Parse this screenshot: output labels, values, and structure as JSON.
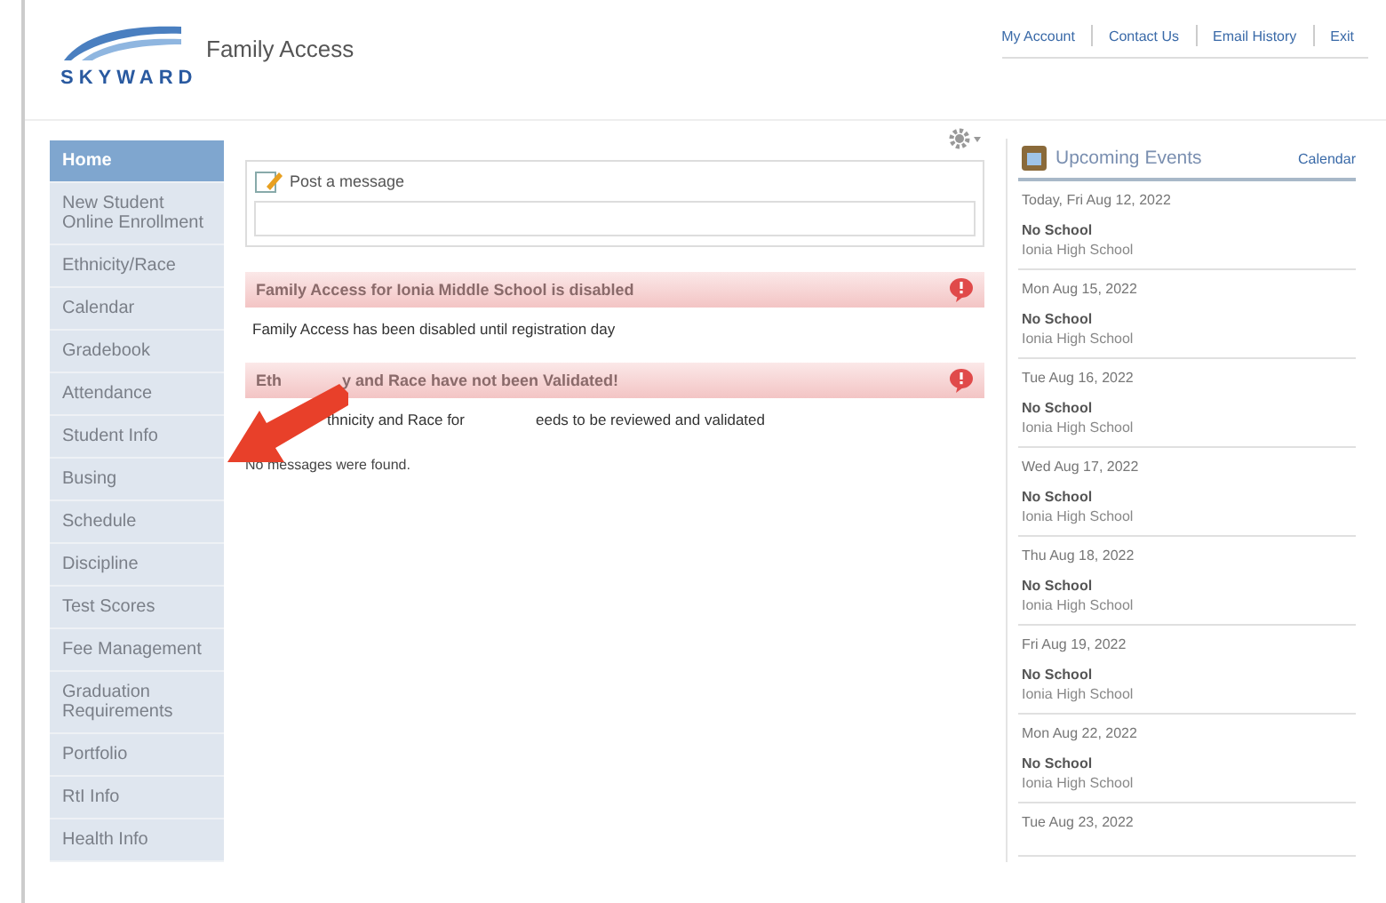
{
  "header": {
    "logo": "SKYWARD",
    "title": "Family Access",
    "links": [
      "My Account",
      "Contact Us",
      "Email History",
      "Exit"
    ]
  },
  "sidebar": {
    "items": [
      {
        "label": "Home",
        "selected": true
      },
      {
        "label": "New Student Online Enrollment",
        "selected": false
      },
      {
        "label": "Ethnicity/Race",
        "selected": false
      },
      {
        "label": "Calendar",
        "selected": false
      },
      {
        "label": "Gradebook",
        "selected": false
      },
      {
        "label": "Attendance",
        "selected": false
      },
      {
        "label": "Student Info",
        "selected": false
      },
      {
        "label": "Busing",
        "selected": false
      },
      {
        "label": "Schedule",
        "selected": false
      },
      {
        "label": "Discipline",
        "selected": false
      },
      {
        "label": "Test Scores",
        "selected": false
      },
      {
        "label": "Fee Management",
        "selected": false
      },
      {
        "label": "Graduation Requirements",
        "selected": false
      },
      {
        "label": "Portfolio",
        "selected": false
      },
      {
        "label": "RtI Info",
        "selected": false
      },
      {
        "label": "Health Info",
        "selected": false
      }
    ]
  },
  "post_box": {
    "label": "Post a message"
  },
  "alerts": [
    {
      "title": [
        "Family Access for Ionia Middle School is disabled"
      ],
      "body": [
        "Family Access has been disabled until registration day"
      ]
    },
    {
      "title": [
        "Eth",
        "y and Race have not been Validated!"
      ],
      "body": [
        "thnicity and Race for",
        "eeds to be reviewed and validated"
      ]
    }
  ],
  "no_messages": "No messages were found.",
  "events": {
    "title": "Upcoming Events",
    "link": "Calendar",
    "items": [
      {
        "date": "Today, Fri Aug 12, 2022",
        "name": "No School",
        "place": "Ionia High School"
      },
      {
        "date": "Mon Aug 15, 2022",
        "name": "No School",
        "place": "Ionia High School"
      },
      {
        "date": "Tue Aug 16, 2022",
        "name": "No School",
        "place": "Ionia High School"
      },
      {
        "date": "Wed Aug 17, 2022",
        "name": "No School",
        "place": "Ionia High School"
      },
      {
        "date": "Thu Aug 18, 2022",
        "name": "No School",
        "place": "Ionia High School"
      },
      {
        "date": "Fri Aug 19, 2022",
        "name": "No School",
        "place": "Ionia High School"
      },
      {
        "date": "Mon Aug 22, 2022",
        "name": "No School",
        "place": "Ionia High School"
      },
      {
        "date": "Tue Aug 23, 2022"
      }
    ]
  },
  "annotation": {
    "arrow": true
  }
}
